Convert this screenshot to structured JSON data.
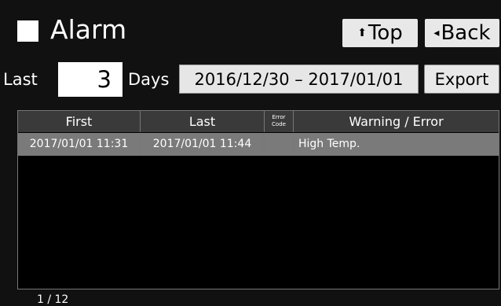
{
  "header": {
    "title": "Alarm",
    "top_label": "Top",
    "back_label": "Back"
  },
  "filter": {
    "last_label": "Last",
    "days_value": "3",
    "days_label": "Days",
    "date_range": "2016/12/30 – 2017/01/01",
    "export_label": "Export"
  },
  "table": {
    "columns": {
      "first": "First",
      "last": "Last",
      "error_code_line1": "Error",
      "error_code_line2": "Code",
      "warning": "Warning / Error"
    },
    "rows": [
      {
        "first": "2017/01/01 11:31",
        "last": "2017/01/01 11:44",
        "code": "",
        "warning": "High Temp."
      }
    ]
  },
  "footer": {
    "page": "1 / 12"
  },
  "colors": {
    "background": "#111111",
    "header_row": "#3a3a3a",
    "selected_row": "#7a7a7a",
    "button": "#e8e8e8"
  },
  "icons": {
    "top_arrow": "up-arrow-icon",
    "back_arrow": "left-triangle-icon",
    "title": "square-icon"
  }
}
